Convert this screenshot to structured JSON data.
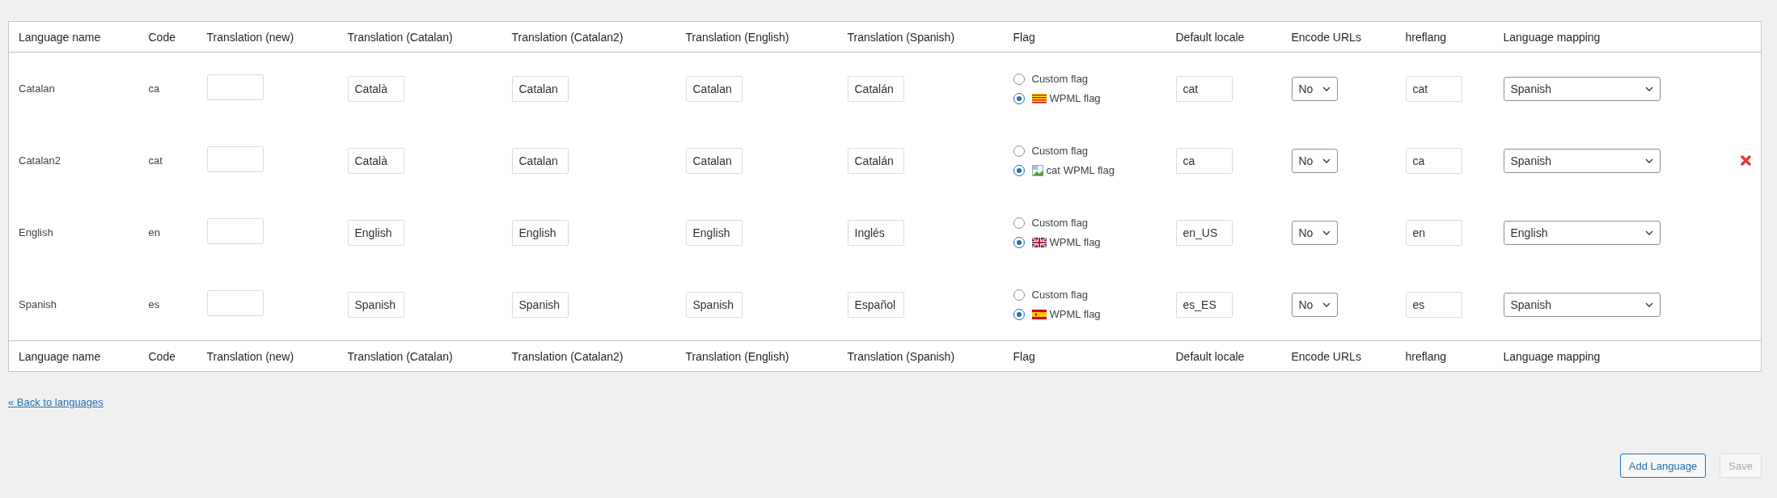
{
  "table": {
    "columns": [
      "Language name",
      "Code",
      "Translation (new)",
      "Translation (Catalan)",
      "Translation (Catalan2)",
      "Translation (English)",
      "Translation (Spanish)",
      "Flag",
      "Default locale",
      "Encode URLs",
      "hreflang",
      "Language mapping"
    ],
    "rows": [
      {
        "name": "Catalan",
        "code": "ca",
        "translations": [
          "Català",
          "Catalan",
          "Catalan",
          "Catalán"
        ],
        "flag_options": [
          {
            "label": "Custom flag",
            "selected": false
          },
          {
            "label": "WPML flag",
            "selected": true,
            "kind": "catalonia"
          }
        ],
        "default_locale": "cat",
        "encode_urls": "No",
        "hreflang": "cat",
        "mapping": "Spanish",
        "deletable": false
      },
      {
        "name": "Catalan2",
        "code": "cat",
        "translations": [
          "Català",
          "Catalan",
          "Catalan",
          "Catalán"
        ],
        "flag_options": [
          {
            "label": "Custom flag",
            "selected": false
          },
          {
            "label": "WPML flag",
            "selected": true,
            "kind": "broken",
            "flag_alt": "cat"
          }
        ],
        "default_locale": "ca",
        "encode_urls": "No",
        "hreflang": "ca",
        "mapping": "Spanish",
        "deletable": true
      },
      {
        "name": "English",
        "code": "en",
        "translations": [
          "English",
          "English",
          "English",
          "Inglés"
        ],
        "flag_options": [
          {
            "label": "Custom flag",
            "selected": false
          },
          {
            "label": "WPML flag",
            "selected": true,
            "kind": "uk"
          }
        ],
        "default_locale": "en_US",
        "encode_urls": "No",
        "hreflang": "en",
        "mapping": "English",
        "deletable": false
      },
      {
        "name": "Spanish",
        "code": "es",
        "translations": [
          "Spanish",
          "Spanish",
          "Spanish",
          "Español"
        ],
        "flag_options": [
          {
            "label": "Custom flag",
            "selected": false
          },
          {
            "label": "WPML flag",
            "selected": true,
            "kind": "spain"
          }
        ],
        "default_locale": "es_ES",
        "encode_urls": "No",
        "hreflang": "es",
        "mapping": "Spanish",
        "deletable": false
      }
    ],
    "footer_columns": [
      "Language name",
      "Code",
      "Translation (new)",
      "Translation (Catalan)",
      "Translation (Catalan2)",
      "Translation (English)",
      "Translation (Spanish)",
      "Flag",
      "Default locale",
      "Encode URLs",
      "hreflang",
      "Language mapping"
    ]
  },
  "back_link": "« Back to languages",
  "buttons": [
    {
      "label": "Add Language",
      "disabled": false
    },
    {
      "label": "Save",
      "disabled": true
    }
  ]
}
